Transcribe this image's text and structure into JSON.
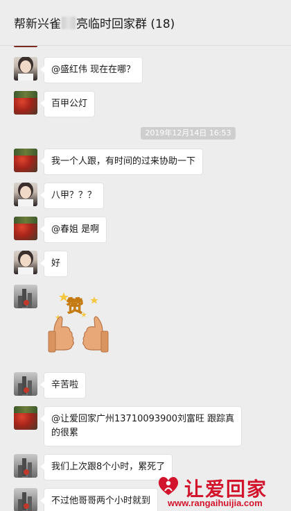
{
  "header": {
    "title_prefix": "帮新兴雀",
    "title_suffix": "亮临时回家群 (18)"
  },
  "timestamp": "2019年12月14日 16:53",
  "messages": [
    {
      "avatar": "girl",
      "text": "@盛红伟 现在在哪？"
    },
    {
      "avatar": "red",
      "text": "百甲公灯"
    },
    {
      "avatar": "red",
      "text": "我一个人跟，有时间的过来协助一下"
    },
    {
      "avatar": "girl",
      "text": "八甲？？？"
    },
    {
      "avatar": "red",
      "text": "@春姐 是啊"
    },
    {
      "avatar": "girl",
      "text": "好"
    },
    {
      "avatar": "city",
      "sticker": "thumbs-up-zan-sticker",
      "sticker_text": "赞"
    },
    {
      "avatar": "city",
      "text": "辛苦啦"
    },
    {
      "avatar": "red",
      "text_line1": "@让爱回家广州13710093900刘富旺 跟踪真",
      "text_line2": "的很累"
    },
    {
      "avatar": "city",
      "text": "我们上次跟8个小时，累死了"
    },
    {
      "avatar": "city",
      "text": "不过他哥哥两个小时就到"
    }
  ],
  "watermark": {
    "brand": "让爱回家",
    "url": "www.rangaihuijia.com"
  },
  "colors": {
    "background": "#ededed",
    "bubble": "#ffffff",
    "brand_red": "#d2142c"
  }
}
